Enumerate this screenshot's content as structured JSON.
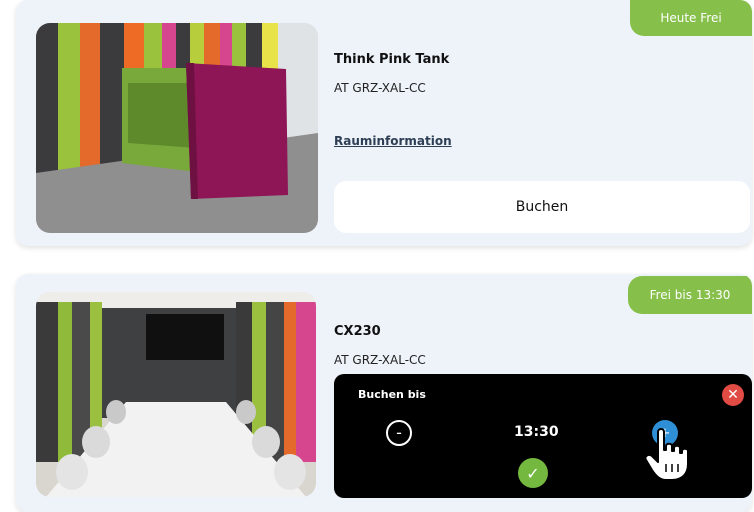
{
  "rooms": [
    {
      "status": "Heute Frei",
      "name": "Think Pink Tank",
      "location": "AT GRZ-XAL-CC",
      "info_link": "Rauminformation",
      "book_label": "Buchen"
    },
    {
      "status": "Frei bis 13:30",
      "name": "CX230",
      "location": "AT GRZ-XAL-CC",
      "booking_panel": {
        "title": "Buchen bis",
        "time": "13:30",
        "close_icon": "close-icon",
        "minus_label": "-",
        "plus_label": "+",
        "confirm_icon": "check-icon"
      }
    }
  ],
  "colors": {
    "status_green": "#86c04a",
    "card_bg": "#edf3f9",
    "panel_bg": "#000000",
    "close_red": "#e04b43",
    "plus_blue": "#2f8fd6",
    "confirm_green": "#75b83f"
  }
}
